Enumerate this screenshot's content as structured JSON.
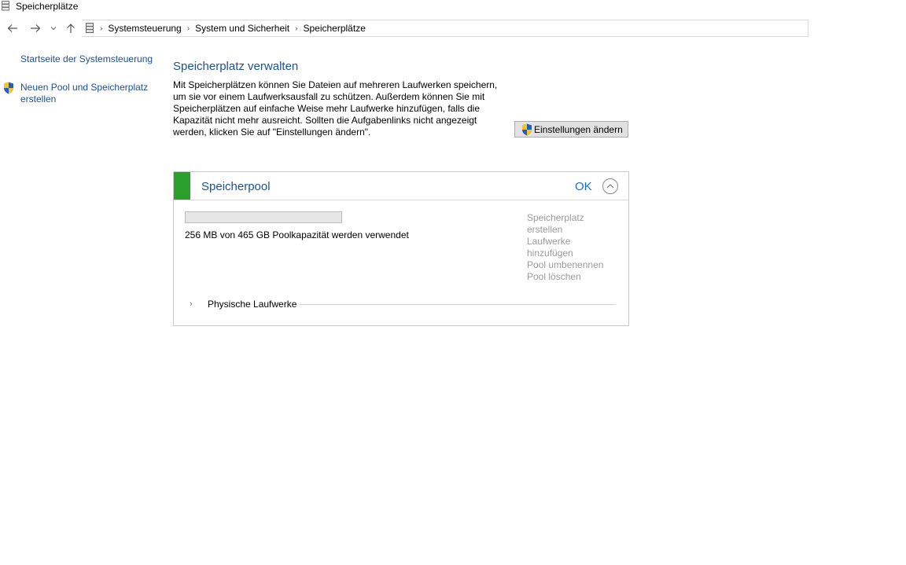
{
  "window": {
    "title": "Speicherplätze"
  },
  "breadcrumb": [
    "Systemsteuerung",
    "System und Sicherheit",
    "Speicherplätze"
  ],
  "leftpane": {
    "home_link": "Startseite der Systemsteuerung",
    "new_pool_link_line1": "Neuen Pool und Speicherplatz",
    "new_pool_link_line2": "erstellen"
  },
  "main": {
    "title": "Speicherplatz verwalten",
    "desc_line1": "Mit Speicherplätzen können Sie Dateien auf mehreren Laufwerken speichern,",
    "desc_line2": "um sie vor einem Laufwerksausfall zu schützen. Außerdem können Sie mit",
    "desc_line3": "Speicherplätzen auf einfache Weise mehr Laufwerke hinzufügen, falls die",
    "desc_line4": "Kapazität nicht mehr ausreicht. Sollten die Aufgabenlinks nicht angezeigt",
    "desc_line5": "werden, klicken Sie auf \"Einstellungen ändern\".",
    "settings_button": "Einstellungen ändern"
  },
  "pool": {
    "name": "Speicherpool",
    "status": "OK",
    "status_color": "#2aa02a",
    "usage_fraction": 0.0,
    "usage_text": "256 MB von 465 GB Poolkapazität werden verwendet",
    "actions": [
      "Speicherplatz",
      "erstellen",
      "Laufwerke",
      "hinzufügen",
      "Pool umbenennen",
      "Pool löschen"
    ],
    "physical_drives_label": "Physische Laufwerke"
  }
}
